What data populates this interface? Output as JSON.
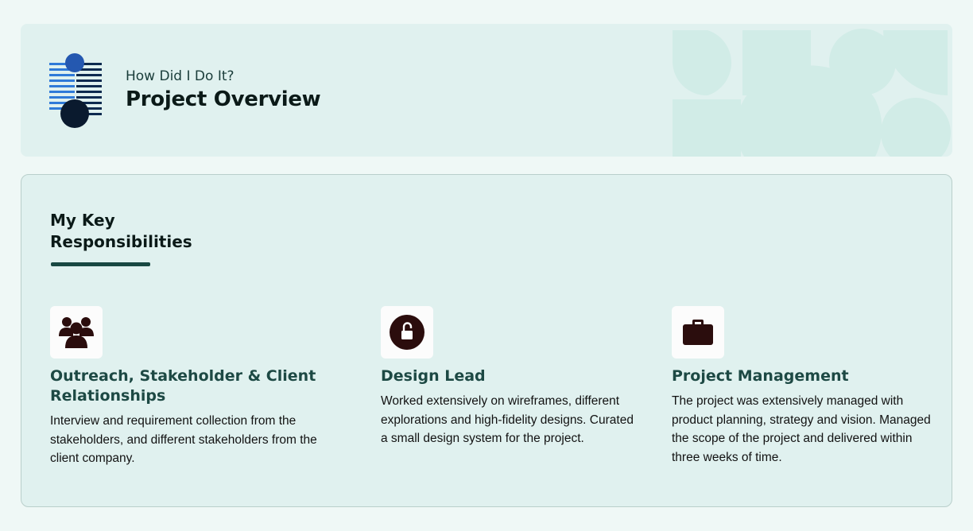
{
  "header": {
    "eyebrow": "How Did I Do It?",
    "title": "Project Overview",
    "logo_icon": "abstract-striped-logo-icon"
  },
  "responsibilities": {
    "heading": "My Key Responsibilities",
    "items": [
      {
        "icon": "group-users-icon",
        "title": "Outreach, Stakeholder & Client Relationships",
        "text": "Interview and requirement collection from the stakeholders, and different stakeholders from the client company."
      },
      {
        "icon": "unlock-icon",
        "title": "Design Lead",
        "text": "Worked extensively on wireframes, different explorations and high-fidelity designs. Curated a small design system for the project."
      },
      {
        "icon": "briefcase-icon",
        "title": "Project Management",
        "text": "The project was extensively managed with product planning, strategy and vision. Managed the scope of the project and delivered within three weeks of time."
      }
    ]
  },
  "colors": {
    "background": "#eff8f6",
    "panel": "#e0f1ef",
    "accent_dark": "#184842",
    "icon_color": "#2b0d0d",
    "logo_blue": "#2f6fd0",
    "logo_navy": "#0d2a4f"
  }
}
